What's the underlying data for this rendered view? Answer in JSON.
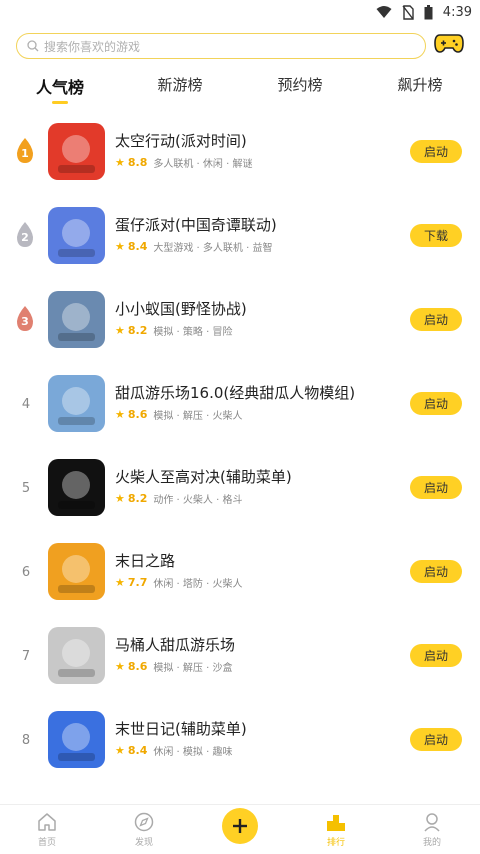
{
  "status_bar": {
    "time": "4:39"
  },
  "search": {
    "placeholder": "搜索你喜欢的游戏"
  },
  "tabs": [
    {
      "label": "人气榜",
      "active": true
    },
    {
      "label": "新游榜",
      "active": false
    },
    {
      "label": "预约榜",
      "active": false
    },
    {
      "label": "飙升榜",
      "active": false
    }
  ],
  "games": [
    {
      "rank": "1",
      "title": "太空行动(派对时间)",
      "score": "8.8",
      "tags": "多人联机 · 休闲 · 解谜",
      "button": "启动",
      "icon_color": "#e23a2a"
    },
    {
      "rank": "2",
      "title": "蛋仔派对(中国奇谭联动)",
      "score": "8.4",
      "tags": "大型游戏 · 多人联机 · 益智",
      "button": "下载",
      "icon_color": "#5a7de0"
    },
    {
      "rank": "3",
      "title": "小小蚁国(野怪协战)",
      "score": "8.2",
      "tags": "模拟 · 策略 · 冒险",
      "button": "启动",
      "icon_color": "#6a8ab0"
    },
    {
      "rank": "4",
      "title": "甜瓜游乐场16.0(经典甜瓜人物模组)",
      "score": "8.6",
      "tags": "模拟 · 解压 · 火柴人",
      "button": "启动",
      "icon_color": "#7aa8d8"
    },
    {
      "rank": "5",
      "title": "火柴人至高对决(辅助菜单)",
      "score": "8.2",
      "tags": "动作 · 火柴人 · 格斗",
      "button": "启动",
      "icon_color": "#111111"
    },
    {
      "rank": "6",
      "title": "末日之路",
      "score": "7.7",
      "tags": "休闲 · 塔防 · 火柴人",
      "button": "启动",
      "icon_color": "#f0a020"
    },
    {
      "rank": "7",
      "title": "马桶人甜瓜游乐场",
      "score": "8.6",
      "tags": "模拟 · 解压 · 沙盒",
      "button": "启动",
      "icon_color": "#c8c8c8"
    },
    {
      "rank": "8",
      "title": "末世日记(辅助菜单)",
      "score": "8.4",
      "tags": "休闲 · 模拟 · 趣味",
      "button": "启动",
      "icon_color": "#3a70e0"
    }
  ],
  "nav": [
    {
      "label": "首页",
      "icon": "home-icon"
    },
    {
      "label": "发现",
      "icon": "compass-icon"
    },
    {
      "label": "",
      "icon": "plus-icon"
    },
    {
      "label": "排行",
      "icon": "ranking-icon"
    },
    {
      "label": "我的",
      "icon": "profile-icon"
    }
  ],
  "colors": {
    "accent": "#ffd024",
    "gold": "#f0a800",
    "medal_1": "#f2a01e",
    "medal_2": "#b8b8c0",
    "medal_3": "#e08070"
  }
}
